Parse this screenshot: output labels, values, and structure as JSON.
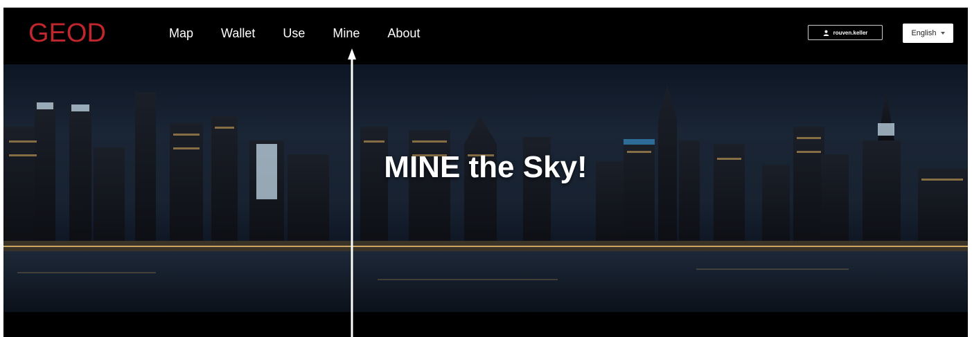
{
  "brand": {
    "logo": "GEOD"
  },
  "nav": {
    "items": [
      {
        "label": "Map"
      },
      {
        "label": "Wallet"
      },
      {
        "label": "Use"
      },
      {
        "label": "Mine"
      },
      {
        "label": "About"
      }
    ]
  },
  "account": {
    "username": "rouven.keller",
    "icon": "user-icon"
  },
  "language": {
    "selected": "English"
  },
  "hero": {
    "headline": "MINE the Sky!"
  },
  "colors": {
    "brand": "#c0262d",
    "nav_bg": "#000000",
    "text": "#ffffff"
  }
}
